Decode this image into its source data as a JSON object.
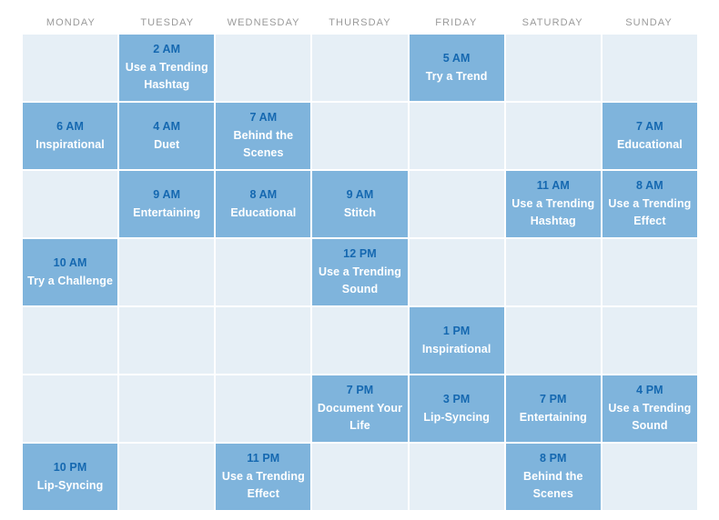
{
  "calendar": {
    "weekdays": [
      "MONDAY",
      "TUESDAY",
      "WEDNESDAY",
      "THURSDAY",
      "FRIDAY",
      "SATURDAY",
      "SUNDAY"
    ],
    "colors": {
      "filled_cell": "#7fb4dc",
      "empty_cell": "#e6eff6",
      "time_text": "#1568b0",
      "activity_text": "#ffffff",
      "header_text": "#9a9a9a",
      "page_background": "#ffffff"
    },
    "rows": [
      [
        {
          "filled": false,
          "time": "",
          "activity": ""
        },
        {
          "filled": true,
          "time": "2 AM",
          "activity": "Use a Trending Hashtag"
        },
        {
          "filled": false,
          "time": "",
          "activity": ""
        },
        {
          "filled": false,
          "time": "",
          "activity": ""
        },
        {
          "filled": true,
          "time": "5 AM",
          "activity": "Try a Trend"
        },
        {
          "filled": false,
          "time": "",
          "activity": ""
        },
        {
          "filled": false,
          "time": "",
          "activity": ""
        }
      ],
      [
        {
          "filled": true,
          "time": "6 AM",
          "activity": "Inspirational"
        },
        {
          "filled": true,
          "time": "4 AM",
          "activity": "Duet"
        },
        {
          "filled": true,
          "time": "7 AM",
          "activity": "Behind the Scenes"
        },
        {
          "filled": false,
          "time": "",
          "activity": ""
        },
        {
          "filled": false,
          "time": "",
          "activity": ""
        },
        {
          "filled": false,
          "time": "",
          "activity": ""
        },
        {
          "filled": true,
          "time": "7 AM",
          "activity": "Educational"
        }
      ],
      [
        {
          "filled": false,
          "time": "",
          "activity": ""
        },
        {
          "filled": true,
          "time": "9 AM",
          "activity": "Entertaining"
        },
        {
          "filled": true,
          "time": "8 AM",
          "activity": "Educational"
        },
        {
          "filled": true,
          "time": "9 AM",
          "activity": "Stitch"
        },
        {
          "filled": false,
          "time": "",
          "activity": ""
        },
        {
          "filled": true,
          "time": "11 AM",
          "activity": "Use a Trending Hashtag"
        },
        {
          "filled": true,
          "time": "8 AM",
          "activity": "Use a Trending Effect"
        }
      ],
      [
        {
          "filled": true,
          "time": "10 AM",
          "activity": "Try a Challenge"
        },
        {
          "filled": false,
          "time": "",
          "activity": ""
        },
        {
          "filled": false,
          "time": "",
          "activity": ""
        },
        {
          "filled": true,
          "time": "12 PM",
          "activity": "Use a Trending Sound"
        },
        {
          "filled": false,
          "time": "",
          "activity": ""
        },
        {
          "filled": false,
          "time": "",
          "activity": ""
        },
        {
          "filled": false,
          "time": "",
          "activity": ""
        }
      ],
      [
        {
          "filled": false,
          "time": "",
          "activity": ""
        },
        {
          "filled": false,
          "time": "",
          "activity": ""
        },
        {
          "filled": false,
          "time": "",
          "activity": ""
        },
        {
          "filled": false,
          "time": "",
          "activity": ""
        },
        {
          "filled": true,
          "time": "1 PM",
          "activity": "Inspirational"
        },
        {
          "filled": false,
          "time": "",
          "activity": ""
        },
        {
          "filled": false,
          "time": "",
          "activity": ""
        }
      ],
      [
        {
          "filled": false,
          "time": "",
          "activity": ""
        },
        {
          "filled": false,
          "time": "",
          "activity": ""
        },
        {
          "filled": false,
          "time": "",
          "activity": ""
        },
        {
          "filled": true,
          "time": "7 PM",
          "activity": "Document Your Life"
        },
        {
          "filled": true,
          "time": "3 PM",
          "activity": "Lip-Syncing"
        },
        {
          "filled": true,
          "time": "7 PM",
          "activity": "Entertaining"
        },
        {
          "filled": true,
          "time": "4 PM",
          "activity": "Use a Trending Sound"
        }
      ],
      [
        {
          "filled": true,
          "time": "10 PM",
          "activity": "Lip-Syncing"
        },
        {
          "filled": false,
          "time": "",
          "activity": ""
        },
        {
          "filled": true,
          "time": "11 PM",
          "activity": "Use a Trending Effect"
        },
        {
          "filled": false,
          "time": "",
          "activity": ""
        },
        {
          "filled": false,
          "time": "",
          "activity": ""
        },
        {
          "filled": true,
          "time": "8 PM",
          "activity": "Behind the Scenes"
        },
        {
          "filled": false,
          "time": "",
          "activity": ""
        }
      ]
    ]
  }
}
